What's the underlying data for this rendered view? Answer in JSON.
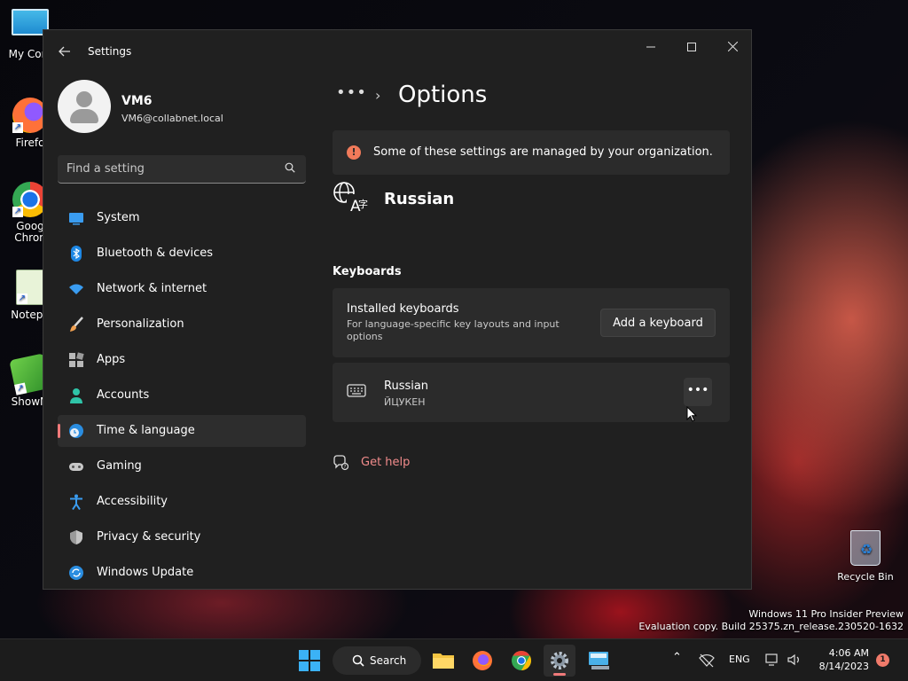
{
  "desktop": {
    "icons": [
      {
        "label": "My Com"
      },
      {
        "label": "Firefo"
      },
      {
        "label": "Goog Chron"
      },
      {
        "label": "Notepa"
      },
      {
        "label": "ShowM"
      }
    ],
    "recycle_bin": "Recycle Bin",
    "watermark": {
      "line1": "Windows 11 Pro Insider Preview",
      "line2": "Evaluation copy. Build 25375.zn_release.230520-1632"
    }
  },
  "window": {
    "title": "Settings",
    "controls": {
      "minimize": "—",
      "maximize": "☐",
      "close": "✕"
    }
  },
  "profile": {
    "name": "VM6",
    "email": "VM6@collabnet.local"
  },
  "search": {
    "placeholder": "Find a setting"
  },
  "nav": {
    "items": [
      {
        "label": "System"
      },
      {
        "label": "Bluetooth & devices"
      },
      {
        "label": "Network & internet"
      },
      {
        "label": "Personalization"
      },
      {
        "label": "Apps"
      },
      {
        "label": "Accounts"
      },
      {
        "label": "Time & language"
      },
      {
        "label": "Gaming"
      },
      {
        "label": "Accessibility"
      },
      {
        "label": "Privacy & security"
      },
      {
        "label": "Windows Update"
      }
    ],
    "active": "Time & language"
  },
  "content": {
    "breadcrumb_more": "•••",
    "breadcrumb_sep": "›",
    "title": "Options",
    "info": "Some of these settings are managed by your organization.",
    "language": "Russian",
    "keyboards_heading": "Keyboards",
    "installed": {
      "title": "Installed keyboards",
      "subtitle": "For language-specific key layouts and input options",
      "button": "Add a keyboard"
    },
    "keyboard": {
      "name": "Russian",
      "layout": "ЙЦУКЕН",
      "more": "•••"
    },
    "help": "Get help"
  },
  "taskbar": {
    "search_label": "Search",
    "tray": {
      "language": "ENG",
      "time": "4:06 AM",
      "date": "8/14/2023",
      "notifications": "1"
    }
  },
  "colors": {
    "accent": "#f07a7a",
    "window_bg": "#202020",
    "card_bg": "#2b2b2b"
  }
}
